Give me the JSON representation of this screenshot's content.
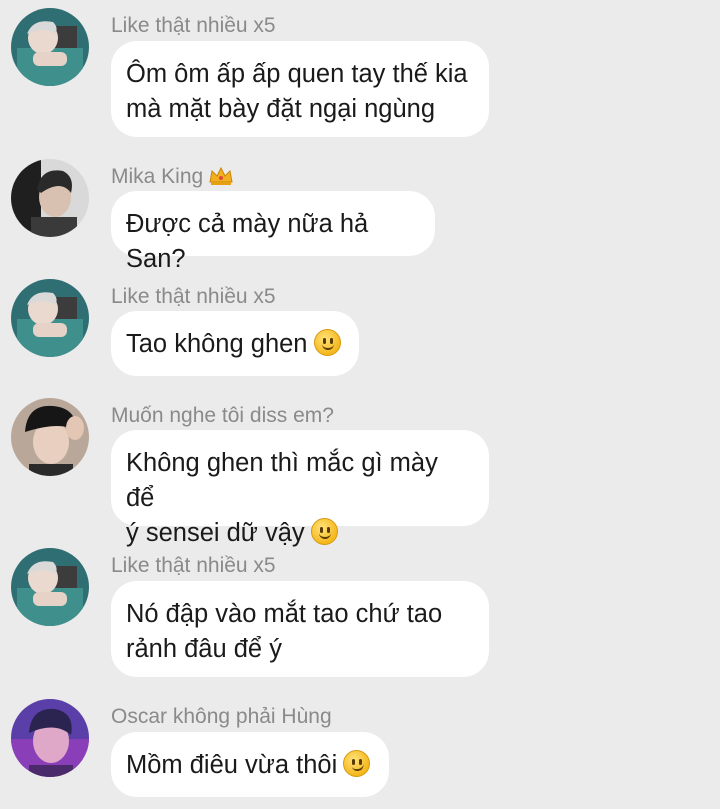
{
  "messages": [
    {
      "sender": "Like thật nhiều x5",
      "avatar": "avatar-gray-hair-man",
      "lines": [
        "Ôm ôm ấp ấp quen tay thế kia",
        "mà mặt bày đặt ngại ngùng"
      ],
      "emoji": null
    },
    {
      "sender": "Mika King",
      "sender_badge": "crown-icon",
      "avatar": "avatar-dark-haired-man",
      "lines": [
        "Được cả mày nữa hả San?"
      ],
      "emoji": null
    },
    {
      "sender": "Like thật nhiều x5",
      "avatar": "avatar-gray-hair-man",
      "lines": [
        "Tao không ghen"
      ],
      "emoji": "slightly-smiling-face-emoji"
    },
    {
      "sender": "Muốn nghe tôi diss em?",
      "avatar": "avatar-man-with-cap",
      "lines": [
        "Không ghen thì mắc gì mày để",
        "ý sensei dữ vậy"
      ],
      "emoji": "slightly-smiling-face-emoji"
    },
    {
      "sender": "Like thật nhiều x5",
      "avatar": "avatar-gray-hair-man",
      "lines": [
        "Nó đập vào mắt tao chứ tao",
        "rảnh đâu để ý"
      ],
      "emoji": null
    },
    {
      "sender": "Oscar không phải Hùng",
      "avatar": "avatar-purple-light-man",
      "lines": [
        "Mồm điêu vừa thôi"
      ],
      "emoji": "smirking-face-emoji"
    }
  ],
  "colors": {
    "background": "#ebebeb",
    "bubble": "#ffffff",
    "sender_text": "#8a8a8a",
    "message_text": "#1a1a1a"
  }
}
